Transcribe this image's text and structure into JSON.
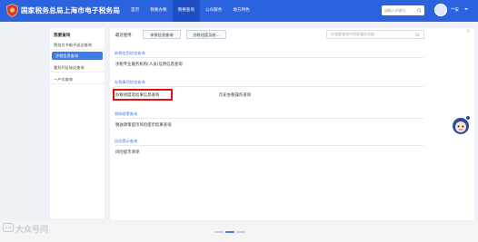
{
  "header": {
    "brand": "国家税务总局上海市电子税务局",
    "nav": [
      {
        "label": "首页",
        "active": false
      },
      {
        "label": "我要办税",
        "active": false
      },
      {
        "label": "我要查询",
        "active": true
      },
      {
        "label": "公众服务",
        "active": false
      },
      {
        "label": "地方特色",
        "active": false
      }
    ],
    "search_placeholder": "请输入关键词",
    "user_name": "**安"
  },
  "sidebar": {
    "title": "我要查询",
    "items": [
      {
        "label": "税务文书电子送达查询",
        "active": false
      },
      {
        "label": "涉税信息查询",
        "active": true
      },
      {
        "label": "委托代征协议查询",
        "active": false
      },
      {
        "label": "一户式查询",
        "active": false
      }
    ]
  },
  "main": {
    "quick_label": "最近使用:",
    "quick_buttons": [
      "申报信息查询",
      "办税进度及结..."
    ],
    "search_placeholder": "在我要查询中搜索服务功能",
    "groups": [
      {
        "title": "纳税信用状态查询",
        "entries": [
          "涉税专业服务机构(人员)信用信息查询"
        ]
      },
      {
        "title": "办税事项状态查询",
        "entries": [
          "办税进度及结果信息查询",
          "历史办税操作查询"
        ]
      },
      {
        "title": "税收政策查询",
        "entries": [
          "税收政策提示风险提示结果查询"
        ]
      },
      {
        "title": "风险提示查询",
        "entries": [
          "风险提示清单"
        ]
      }
    ]
  },
  "bottom": {
    "watermark": "大众号问"
  },
  "colors": {
    "header_blue": "#2b62de",
    "active_blue": "#3d7be8",
    "highlight_red": "#e21212"
  }
}
